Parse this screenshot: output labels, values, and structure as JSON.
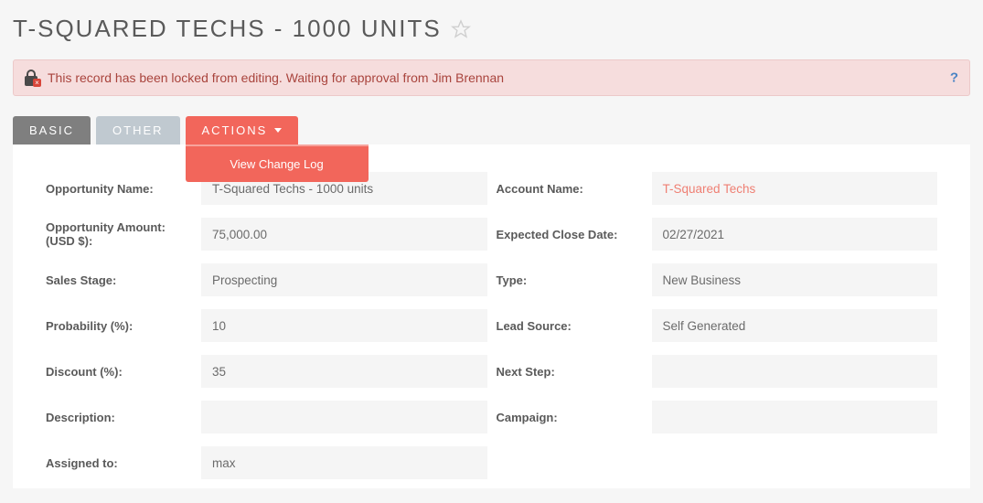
{
  "title": "T-SQUARED TECHS - 1000 UNITS",
  "alert": {
    "text": "This record has been locked from editing. Waiting for approval from Jim Brennan",
    "help": "?"
  },
  "tabs": {
    "basic": "BASIC",
    "other": "OTHER",
    "actions": "ACTIONS"
  },
  "dropdown": {
    "view_change_log": "View Change Log"
  },
  "labels": {
    "opportunity_name": "Opportunity Name:",
    "account_name": "Account Name:",
    "opportunity_amount": "Opportunity Amount: (USD $):",
    "expected_close_date": "Expected Close Date:",
    "sales_stage": "Sales Stage:",
    "type": "Type:",
    "probability": "Probability (%):",
    "lead_source": "Lead Source:",
    "discount": "Discount (%):",
    "next_step": "Next Step:",
    "description": "Description:",
    "campaign": "Campaign:",
    "assigned_to": "Assigned to:"
  },
  "values": {
    "opportunity_name": "T-Squared Techs - 1000 units",
    "account_name": "T-Squared Techs",
    "opportunity_amount": "75,000.00",
    "expected_close_date": "02/27/2021",
    "sales_stage": "Prospecting",
    "type": "New Business",
    "probability": "10",
    "lead_source": "Self Generated",
    "discount": "35",
    "next_step": "",
    "description": "",
    "campaign": "",
    "assigned_to": "max"
  }
}
